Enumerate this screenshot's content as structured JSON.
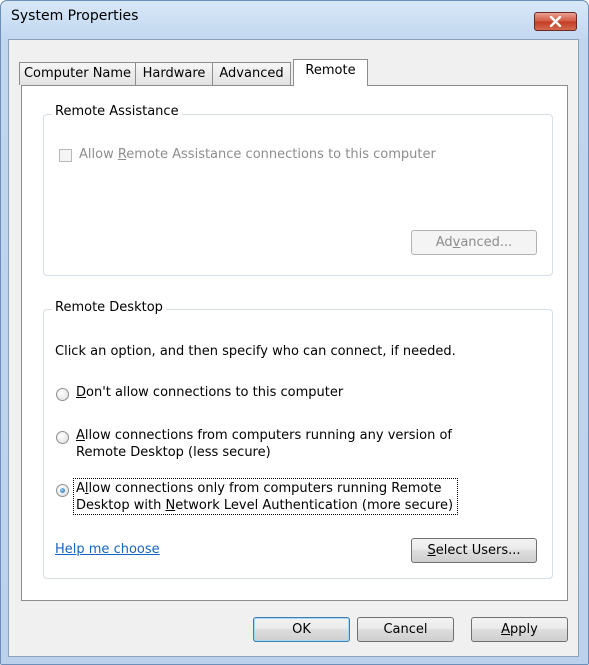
{
  "window": {
    "title": "System Properties",
    "close_icon": "close-x-icon",
    "close_color": "#c23b22"
  },
  "tabs": [
    {
      "label": "Computer Name",
      "active": false
    },
    {
      "label": "Hardware",
      "active": false
    },
    {
      "label": "Advanced",
      "active": false
    },
    {
      "label": "Remote",
      "active": true
    }
  ],
  "remote_assistance": {
    "group_label": "Remote Assistance",
    "checkbox": {
      "label_pre": "Allow ",
      "label_key": "R",
      "label_post": "emote Assistance connections to this computer",
      "checked": false,
      "enabled": false
    },
    "advanced_button": {
      "pre": "Ad",
      "key": "v",
      "post": "anced...",
      "enabled": false
    }
  },
  "remote_desktop": {
    "group_label": "Remote Desktop",
    "instruction": "Click an option, and then specify who can connect, if needed.",
    "options": [
      {
        "pre": "",
        "key": "D",
        "line1_rest": "on't allow connections to this computer",
        "line2": "",
        "checked": false
      },
      {
        "pre": "",
        "key": "A",
        "line1_rest": "llow connections from computers running any version of",
        "line2": "Remote Desktop (less secure)",
        "checked": false
      },
      {
        "pre": "A",
        "key": "l",
        "line1_rest": "low connections only from computers running Remote",
        "line2_pre": "Desktop with ",
        "line2_key": "N",
        "line2_rest": "etwork Level Authentication (more secure)",
        "checked": true
      }
    ],
    "help_link": "Help me choose",
    "select_users_button": {
      "key": "S",
      "rest": "elect Users..."
    }
  },
  "footer": {
    "ok": "OK",
    "cancel": "Cancel",
    "apply_key": "A",
    "apply_rest": "pply"
  }
}
